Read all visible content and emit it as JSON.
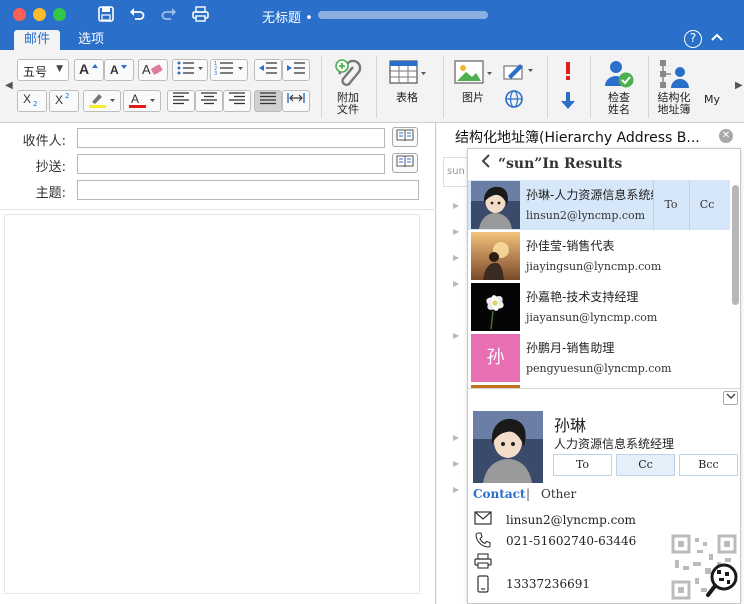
{
  "window": {
    "title": "无标题 •"
  },
  "tabs": [
    {
      "label": "邮件"
    },
    {
      "label": "选项"
    }
  ],
  "ribbon": {
    "font_size_value": "五号",
    "attach_label": "附加文件",
    "attach_line1": "附加",
    "attach_line2": "文件",
    "table_label": "表格",
    "picture_label": "图片",
    "check_names_line1": "检查",
    "check_names_line2": "姓名",
    "hier_line1": "结构化",
    "hier_line2": "地址簿",
    "my_label": "My"
  },
  "compose": {
    "to_label": "收件人:",
    "cc_label": "抄送:",
    "subject_label": "主题:",
    "to_value": "",
    "cc_value": "",
    "subject_value": ""
  },
  "address_pane": {
    "title": "结构化地址簿(Hierarchy Address B...",
    "search_hint": "sun",
    "results_title": "“sun”In Results",
    "results": [
      {
        "name": "孙琳-人力资源信息系统经理",
        "email": "linsun2@lyncmp.com",
        "selected": true
      },
      {
        "name": "孙佳莹-销售代表",
        "email": "jiayingsun@lyncmp.com",
        "selected": false
      },
      {
        "name": "孙嘉艳-技术支持经理",
        "email": "jiayansun@lyncmp.com",
        "selected": false
      },
      {
        "name": "孙鹏月-销售助理",
        "email": "pengyuesun@lyncmp.com",
        "selected": false,
        "avatar_char": "孙"
      }
    ],
    "row_to": "To",
    "row_cc": "Cc",
    "detail": {
      "name": "孙琳",
      "title": "人力资源信息系统经理",
      "btn_to": "To",
      "btn_cc": "Cc",
      "btn_bcc": "Bcc",
      "tab_contact": "Contact",
      "tab_sep": "|",
      "tab_other": "Other",
      "email": "linsun2@lyncmp.com",
      "phone": "021-51602740-63446",
      "fax": "",
      "mobile": "13337236691"
    }
  },
  "colors": {
    "accent": "#2a6fc9",
    "selected_row": "#d5e7f8",
    "avatar_pink": "#e86fb1"
  },
  "icons": {
    "save": "save-icon",
    "undo": "undo-icon",
    "redo": "redo-icon",
    "print": "print-icon",
    "help": "help-icon",
    "close": "close-icon"
  }
}
